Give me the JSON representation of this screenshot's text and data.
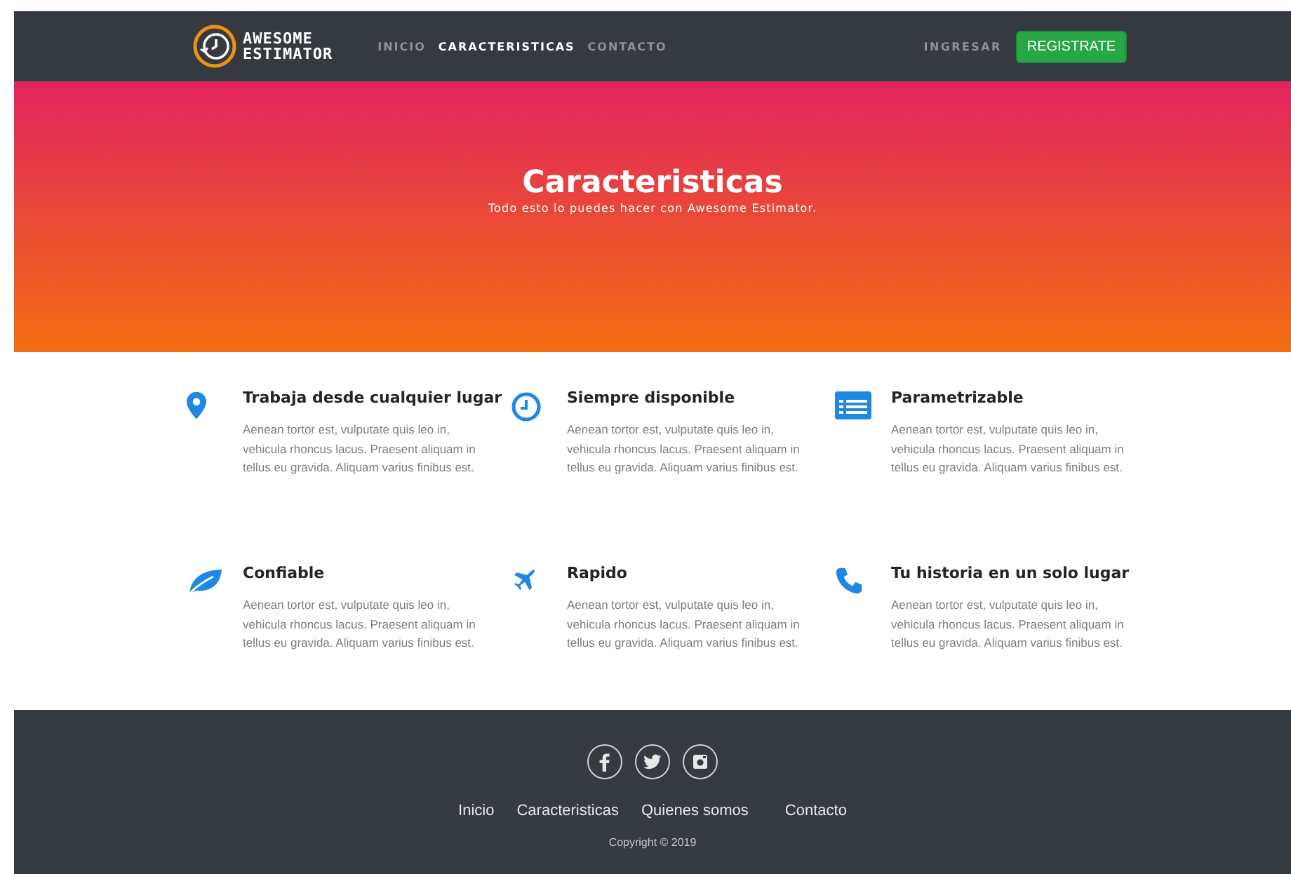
{
  "header": {
    "logo": [
      "AWESOME",
      "ESTIMATOR"
    ],
    "nav": [
      {
        "label": "INICIO",
        "selected": false
      },
      {
        "label": "CARACTERISTICAS",
        "selected": true
      },
      {
        "label": "CONTACTO",
        "selected": false
      }
    ],
    "login": "INGRESAR",
    "register": "REGISTRATE"
  },
  "hero": {
    "title": "Caracteristicas",
    "subtitle": "Todo esto lo puedes hacer con Awesome Estimator."
  },
  "features": [
    {
      "kind": "pin",
      "title": "Trabaja desde cualquier lugar",
      "text": "Aenean tortor est, vulputate quis leo in, vehicula rhoncus lacus. Praesent aliquam in tellus eu gravida. Aliquam varius finibus est."
    },
    {
      "kind": "clock",
      "title": "Siempre disponible",
      "text": "Aenean tortor est, vulputate quis leo in, vehicula rhoncus lacus. Praesent aliquam in tellus eu gravida. Aliquam varius finibus est."
    },
    {
      "kind": "list",
      "title": "Parametrizable",
      "text": "Aenean tortor est, vulputate quis leo in, vehicula rhoncus lacus. Praesent aliquam in tellus eu gravida. Aliquam varius finibus est."
    },
    {
      "kind": "leaf",
      "title": "Confiable",
      "text": "Aenean tortor est, vulputate quis leo in, vehicula rhoncus lacus. Praesent aliquam in tellus eu gravida. Aliquam varius finibus est."
    },
    {
      "kind": "plane",
      "title": "Rapido",
      "text": "Aenean tortor est, vulputate quis leo in, vehicula rhoncus lacus. Praesent aliquam in tellus eu gravida. Aliquam varius finibus est."
    },
    {
      "kind": "phone",
      "title": "Tu historia en un solo lugar",
      "text": "Aenean tortor est, vulputate quis leo in, vehicula rhoncus lacus. Praesent aliquam in tellus eu gravida. Aliquam varius finibus est."
    }
  ],
  "footer": {
    "social": [
      {
        "kind": "facebook"
      },
      {
        "kind": "twitter"
      },
      {
        "kind": "instagram"
      }
    ],
    "links": [
      "Inicio",
      "Caracteristicas",
      "Quienes somos",
      "Contacto"
    ],
    "copyright": "Copyright  © 2019"
  }
}
